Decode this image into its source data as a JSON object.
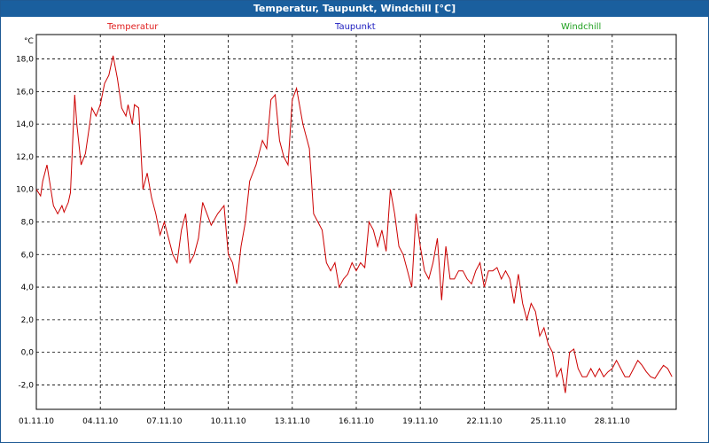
{
  "title": "Temperatur, Taupunkt, Windchill [°C]",
  "legend": [
    {
      "name": "Temperatur",
      "color": "#e02020"
    },
    {
      "name": "Taupunkt",
      "color": "#2020c0"
    },
    {
      "name": "Windchill",
      "color": "#20a020"
    }
  ],
  "chart_data": {
    "type": "line",
    "title": "Temperatur, Taupunkt, Windchill [°C]",
    "ylabel": "°C",
    "xlabel": "",
    "ylim": [
      -3.5,
      19.5
    ],
    "xlim": [
      "01.11.10",
      "30.11.10"
    ],
    "y_ticks": [
      "18,0",
      "16,0",
      "14,0",
      "12,0",
      "10,0",
      "8,0",
      "6,0",
      "4,0",
      "2,0",
      "0,0",
      "-2,0"
    ],
    "x_ticks": [
      "01.11.10",
      "04.11.10",
      "07.11.10",
      "10.11.10",
      "13.11.10",
      "16.11.10",
      "19.11.10",
      "22.11.10",
      "25.11.10",
      "28.11.10"
    ],
    "grid": true,
    "series": [
      {
        "name": "Temperatur",
        "color": "#cc0000",
        "x": [
          0,
          0.2,
          0.3,
          0.5,
          0.8,
          1.0,
          1.2,
          1.3,
          1.5,
          1.6,
          1.8,
          1.9,
          2.1,
          2.3,
          2.5,
          2.6,
          2.8,
          3.0,
          3.2,
          3.4,
          3.6,
          3.8,
          4.0,
          4.2,
          4.3,
          4.5,
          4.6,
          4.8,
          5.0,
          5.2,
          5.4,
          5.6,
          5.8,
          6.0,
          6.2,
          6.4,
          6.6,
          6.8,
          7.0,
          7.2,
          7.4,
          7.6,
          7.8,
          8.0,
          8.2,
          8.5,
          8.8,
          9.0,
          9.2,
          9.4,
          9.6,
          9.8,
          10.0,
          10.3,
          10.6,
          10.8,
          11.0,
          11.2,
          11.4,
          11.6,
          11.8,
          12.0,
          12.2,
          12.5,
          12.8,
          13.0,
          13.2,
          13.4,
          13.6,
          13.8,
          14.0,
          14.2,
          14.4,
          14.6,
          14.8,
          15.0,
          15.2,
          15.4,
          15.6,
          15.8,
          16.0,
          16.2,
          16.4,
          16.6,
          16.8,
          17.0,
          17.2,
          17.4,
          17.6,
          17.8,
          18.0,
          18.2,
          18.4,
          18.6,
          18.8,
          19.0,
          19.2,
          19.4,
          19.6,
          19.8,
          20.0,
          20.2,
          20.4,
          20.6,
          20.8,
          21.0,
          21.2,
          21.4,
          21.6,
          21.8,
          22.0,
          22.2,
          22.4,
          22.6,
          22.8,
          23.0,
          23.2,
          23.4,
          23.6,
          23.8,
          24.0,
          24.2,
          24.4,
          24.6,
          24.8,
          25.0,
          25.2,
          25.4,
          25.6,
          25.8,
          26.0,
          26.2,
          26.4,
          26.6,
          26.8,
          27.0,
          27.2,
          27.4,
          27.6,
          27.8,
          28.0,
          28.2,
          28.4,
          28.6,
          28.8,
          29.0,
          29.2,
          29.4,
          29.6,
          29.8
        ],
        "y": [
          10.0,
          9.6,
          10.5,
          11.5,
          9.0,
          8.5,
          9.0,
          8.6,
          9.2,
          9.8,
          15.8,
          14.0,
          11.5,
          12.2,
          14.0,
          15.0,
          14.5,
          15.2,
          16.5,
          17.0,
          18.2,
          16.8,
          15.0,
          14.5,
          15.2,
          14.0,
          15.2,
          15.0,
          10.0,
          11.0,
          9.5,
          8.5,
          7.2,
          8.0,
          7.0,
          6.0,
          5.5,
          7.5,
          8.5,
          5.5,
          6.0,
          7.0,
          9.2,
          8.5,
          7.8,
          8.5,
          9.0,
          6.0,
          5.5,
          4.2,
          6.5,
          8.0,
          10.5,
          11.5,
          13.0,
          12.5,
          15.5,
          15.8,
          13.0,
          12.0,
          11.5,
          15.5,
          16.2,
          14.0,
          12.5,
          8.5,
          8.0,
          7.5,
          5.5,
          5.0,
          5.5,
          4.0,
          4.5,
          4.8,
          5.5,
          5.0,
          5.5,
          5.2,
          8.0,
          7.5,
          6.5,
          7.5,
          6.2,
          10.0,
          8.5,
          6.5,
          6.0,
          5.0,
          4.0,
          8.5,
          6.5,
          5.0,
          4.5,
          5.5,
          7.0,
          3.2,
          6.5,
          4.5,
          4.5,
          5.0,
          5.0,
          4.5,
          4.2,
          5.0,
          5.5,
          4.0,
          5.0,
          5.0,
          5.2,
          4.5,
          5.0,
          4.5,
          3.0,
          4.8,
          3.0,
          2.0,
          3.0,
          2.5,
          1.0,
          1.5,
          0.5,
          0.0,
          -1.5,
          -1.0,
          -2.5,
          0.0,
          0.2,
          -1.0,
          -1.5,
          -1.5,
          -1.0,
          -1.5,
          -1.0,
          -1.5,
          -1.2,
          -1.0,
          -0.5,
          -1.0,
          -1.5,
          -1.5,
          -1.0,
          -0.5,
          -0.8,
          -1.2,
          -1.5,
          -1.6,
          -1.2,
          -0.8,
          -1.0,
          -1.5
        ]
      }
    ]
  }
}
